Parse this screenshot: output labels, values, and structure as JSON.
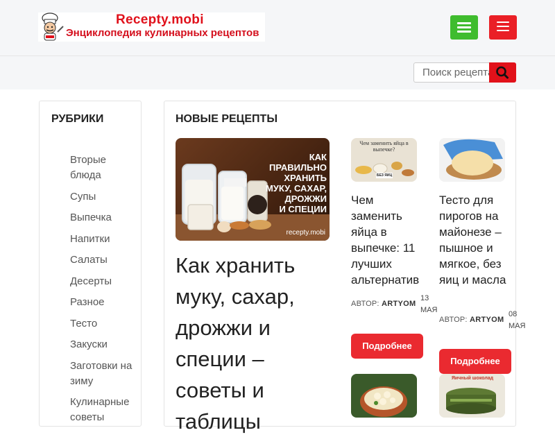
{
  "header": {
    "logo_name": "Recepty.mobi",
    "logo_tagline": "Энциклопедия кулинарных рецептов",
    "menu_icon": "hamburger-icon",
    "menu2_icon": "hamburger-icon"
  },
  "search": {
    "placeholder": "Поиск рецепта",
    "icon": "search-icon"
  },
  "sidebar": {
    "title": "РУБРИКИ",
    "items": [
      "Вторые блюда",
      "Супы",
      "Выпечка",
      "Напитки",
      "Салаты",
      "Десерты",
      "Разное",
      "Тесто",
      "Закуски",
      "Заготовки на зиму",
      "Кулинарные советы"
    ]
  },
  "main": {
    "title": "НОВЫЕ РЕЦЕПТЫ",
    "hero": {
      "image_text": [
        "КАК",
        "ПРАВИЛЬНО",
        "ХРАНИТЬ",
        "МУКУ, САХАР,",
        "ДРОЖЖИ",
        "И СПЕЦИИ"
      ],
      "watermark": "recepty.mobi",
      "title": "Как хранить муку, сахар, дрожжи и специи – советы и таблицы"
    },
    "cards": [
      {
        "image_caption": "Чем заменить яйца в выпечке?",
        "image_badge": "БЕЗ ЯИЦ",
        "title": "Чем заменить яйца в выпечке: 11 лучших альтернатив",
        "author_label": "АВТОР:",
        "author": "ARTYOM",
        "date_day": "13",
        "date_month": "МАЯ",
        "button": "Подробнее"
      },
      {
        "title": "Тесто для пирогов на майонезе – пышное и мягкое, без яиц и масла",
        "author_label": "АВТОР:",
        "author": "ARTYOM",
        "date_day": "08",
        "date_month": "МАЯ",
        "button": "Подробнее"
      }
    ],
    "bottom_card_caption": "Яичный шоколад"
  },
  "colors": {
    "brand_red": "#e0111b",
    "menu_green": "#3fbc2e",
    "button_red": "#ea2a30"
  }
}
